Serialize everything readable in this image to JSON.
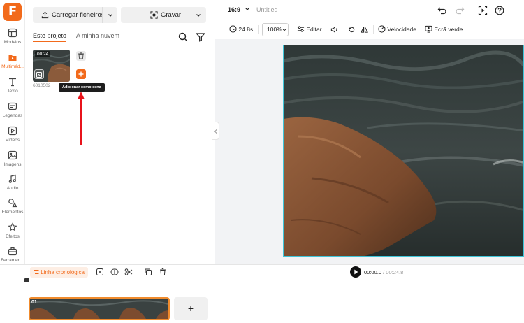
{
  "brand": {
    "logo_letter": "F",
    "accent": "#f26a1b"
  },
  "rail": {
    "items": [
      {
        "label": "Modelos",
        "icon": "templates-icon"
      },
      {
        "label": "Multiméd...",
        "icon": "media-icon",
        "active": true
      },
      {
        "label": "Texto",
        "icon": "text-icon"
      },
      {
        "label": "Legendas",
        "icon": "captions-icon"
      },
      {
        "label": "Vídeos",
        "icon": "videos-icon"
      },
      {
        "label": "Imagens",
        "icon": "images-icon"
      },
      {
        "label": "Áudio",
        "icon": "audio-icon"
      },
      {
        "label": "Elementos",
        "icon": "elements-icon"
      },
      {
        "label": "Efeitos",
        "icon": "effects-icon"
      },
      {
        "label": "Ferramen...",
        "icon": "tools-icon"
      }
    ]
  },
  "panel": {
    "upload_label": "Carregar ficheiros",
    "record_label": "Gravar",
    "tab_project": "Este projeto",
    "tab_cloud": "A minha nuvem",
    "media": {
      "duration": "00:24",
      "caption": "6010502",
      "tooltip": "Adicionar como cena"
    }
  },
  "topbar": {
    "aspect_ratio": "16:9",
    "title": "Untitled"
  },
  "toolbar": {
    "duration": "24.8s",
    "zoom": "100%",
    "edit_label": "Editar",
    "speed_label": "Velocidade",
    "greenscreen_label": "Ecrã verde"
  },
  "timeline": {
    "label": "Linha cronológica",
    "current_time": "00:00.0",
    "total_time": "/ 00:24.8",
    "clip_number": "01",
    "add_scene": "+"
  }
}
